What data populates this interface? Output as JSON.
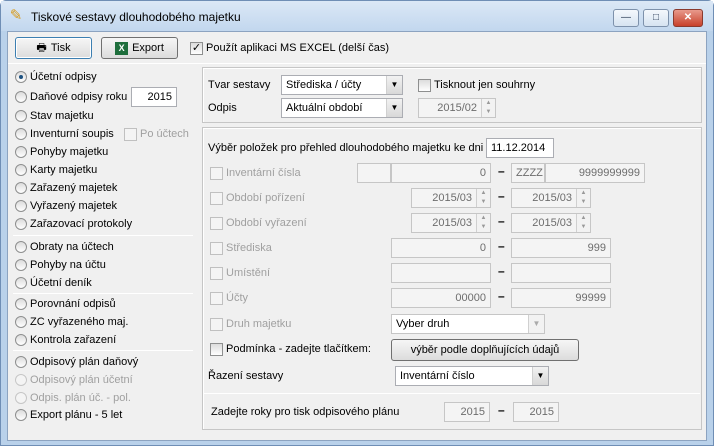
{
  "window": {
    "title": "Tiskové sestavy dlouhodobého majetku",
    "min": "—",
    "max": "□",
    "close": "✕"
  },
  "toolbar": {
    "print": "Tisk",
    "export": "Export",
    "excel_label": "Použít aplikaci MS EXCEL (delší čas)"
  },
  "left": {
    "items": [
      "Účetní odpisy",
      "Daňové odpisy roku",
      "Stav majetku",
      "Inventurní soupis",
      "Pohyby majetku",
      "Karty majetku",
      "Zařazený majetek",
      "Vyřazený majetek",
      "Zařazovací protokoly"
    ],
    "year": "2015",
    "po_uctech": "Po účtech",
    "items2": [
      "Obraty na účtech",
      "Pohyby na účtu",
      "Účetní deník"
    ],
    "items3": [
      "Porovnání odpisů",
      "ZC vyřazeného maj.",
      "Kontrola zařazení"
    ],
    "items4": [
      "Odpisový plán daňový",
      "Odpisový plán účetní",
      "Odpis. plán úč. - pol.",
      "Export plánu - 5 let"
    ]
  },
  "top": {
    "tvar_label": "Tvar sestavy",
    "tvar_value": "Střediska / účty",
    "odpis_label": "Odpis",
    "odpis_value": "Aktuální období",
    "souhrn_label": "Tisknout jen souhrny",
    "period": "2015/02"
  },
  "main": {
    "header": "Výběr položek pro přehled dlouhodobého majetku ke dni",
    "date": "11.12.2014",
    "inv_label": "Inventární čísla",
    "inv_from": "0",
    "inv_z": "ZZZZ",
    "inv_to": "9999999999",
    "por_label": "Období pořízení",
    "por_from": "2015/03",
    "por_to": "2015/03",
    "vyr_label": "Období vyřazení",
    "vyr_from": "2015/03",
    "vyr_to": "2015/03",
    "str_label": "Střediska",
    "str_from": "0",
    "str_to": "999",
    "umi_label": "Umístění",
    "uct_label": "Účty",
    "uct_from": "00000",
    "uct_to": "99999",
    "druh_label": "Druh majetku",
    "druh_value": "Vyber druh",
    "podm_label": "Podmínka - zadejte tlačítkem:",
    "podm_button": "výběr podle doplňujících údajů",
    "razeni_label": "Řazení sestavy",
    "razeni_value": "Inventární číslo",
    "roky_label": "Zadejte roky pro tisk odpisového plánu",
    "rok_from": "2015",
    "rok_to": "2015",
    "dash": "–"
  }
}
